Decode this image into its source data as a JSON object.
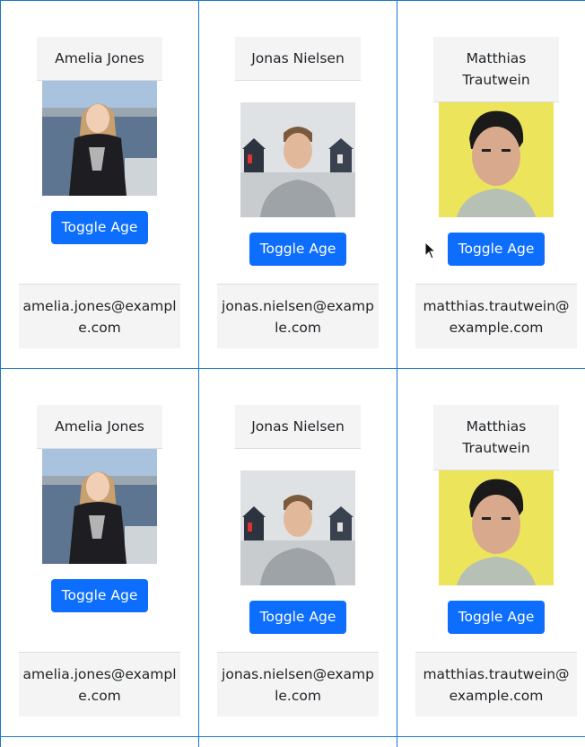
{
  "cards": [
    {
      "name": "Amelia Jones",
      "button": "Toggle Age",
      "email": "amelia.jones@example.com"
    },
    {
      "name": "Jonas Nielsen",
      "button": "Toggle Age",
      "email": "jonas.nielsen@example.com"
    },
    {
      "name": "Matthias Trautwein",
      "button": "Toggle Age",
      "email": "matthias.trautwein@example.com"
    },
    {
      "name": "Amelia Jones",
      "button": "Toggle Age",
      "email": "amelia.jones@example.com"
    },
    {
      "name": "Jonas Nielsen",
      "button": "Toggle Age",
      "email": "jonas.nielsen@example.com"
    },
    {
      "name": "Matthias Trautwein",
      "button": "Toggle Age",
      "email": "matthias.trautwein@example.com"
    }
  ],
  "colors": {
    "accent": "#0d6efd",
    "border": "#1c75c8",
    "panel": "#f4f4f4"
  }
}
